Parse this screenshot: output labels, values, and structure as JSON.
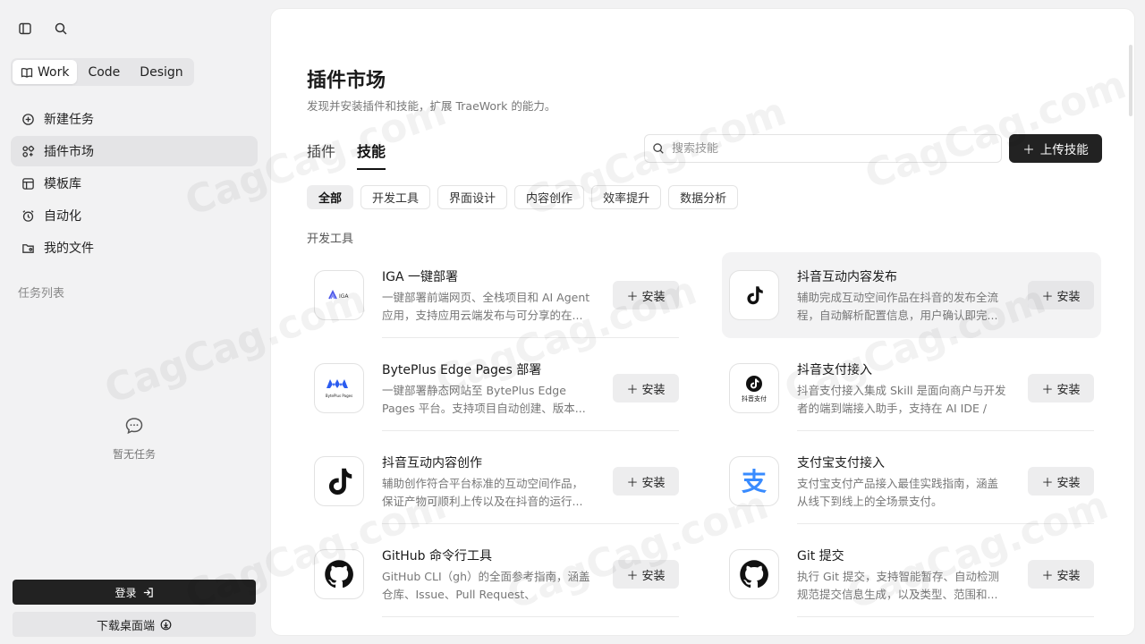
{
  "sidebar": {
    "modes": [
      {
        "label": "Work",
        "active": true
      },
      {
        "label": "Code",
        "active": false
      },
      {
        "label": "Design",
        "active": false
      }
    ],
    "nav": [
      {
        "label": "新建任务",
        "icon": "plus-circle-icon"
      },
      {
        "label": "插件市场",
        "icon": "plugin-grid-icon",
        "active": true
      },
      {
        "label": "模板库",
        "icon": "template-icon"
      },
      {
        "label": "自动化",
        "icon": "alarm-clock-icon"
      },
      {
        "label": "我的文件",
        "icon": "folder-user-icon"
      }
    ],
    "task_list_label": "任务列表",
    "empty_text": "暂无任务",
    "login_label": "登录",
    "download_label": "下载桌面端"
  },
  "main": {
    "title": "插件市场",
    "subtitle": "发现并安装插件和技能，扩展 TraeWork 的能力。",
    "tabs": [
      "插件",
      "技能"
    ],
    "active_tab": 1,
    "search_placeholder": "搜索技能",
    "upload_label": "上传技能",
    "filters": [
      "全部",
      "开发工具",
      "界面设计",
      "内容创作",
      "效率提升",
      "数据分析"
    ],
    "active_filter": 0,
    "group_label": "开发工具",
    "install_label": "安装",
    "cards": [
      {
        "title": "IGA 一键部署",
        "desc": "一键部署前端网页、全栈项目和 AI Agent 应用，支持应用云端发布与可分享的在...",
        "icon": "iga-logo-icon"
      },
      {
        "title": "抖音互动内容发布",
        "desc": "辅助完成互动空间作品在抖音的发布全流程，自动解析配置信息，用户确认即完...",
        "icon": "tiktok-logo-icon",
        "highlight": true
      },
      {
        "title": "BytePlus Edge Pages 部署",
        "desc": "一键部署静态网站至 BytePlus Edge Pages 平台。支持项目自动创建、版本...",
        "icon": "byteplus-logo-icon"
      },
      {
        "title": "抖音支付接入",
        "desc": "抖音支付接入集成 Skill 是面向商户与开发者的端到端接入助手，支持在 AI IDE / AI...",
        "icon": "douyin-pay-logo-icon"
      },
      {
        "title": "抖音互动内容创作",
        "desc": "辅助创作符合平台标准的互动空间作品，保证产物可顺利上传以及在抖音的运行...",
        "icon": "tiktok-logo-icon"
      },
      {
        "title": "支付宝支付接入",
        "desc": "支付宝支付产品接入最佳实践指南，涵盖从线下到线上的全场景支付。",
        "icon": "alipay-logo-icon"
      },
      {
        "title": "GitHub 命令行工具",
        "desc": "GitHub CLI（gh）的全面参考指南，涵盖仓库、Issue、Pull Request、Actions、...",
        "icon": "github-logo-icon"
      },
      {
        "title": "Git 提交",
        "desc": "执行 Git 提交，支持智能暂存、自动检测规范提交信息生成，以及类型、范围和...",
        "icon": "github-logo-icon"
      }
    ],
    "logo_text": {
      "iga": "IGA",
      "byteplus": "BytePlus Pages",
      "douyin_pay": "抖音支付"
    }
  },
  "watermark": "CagCag.com"
}
